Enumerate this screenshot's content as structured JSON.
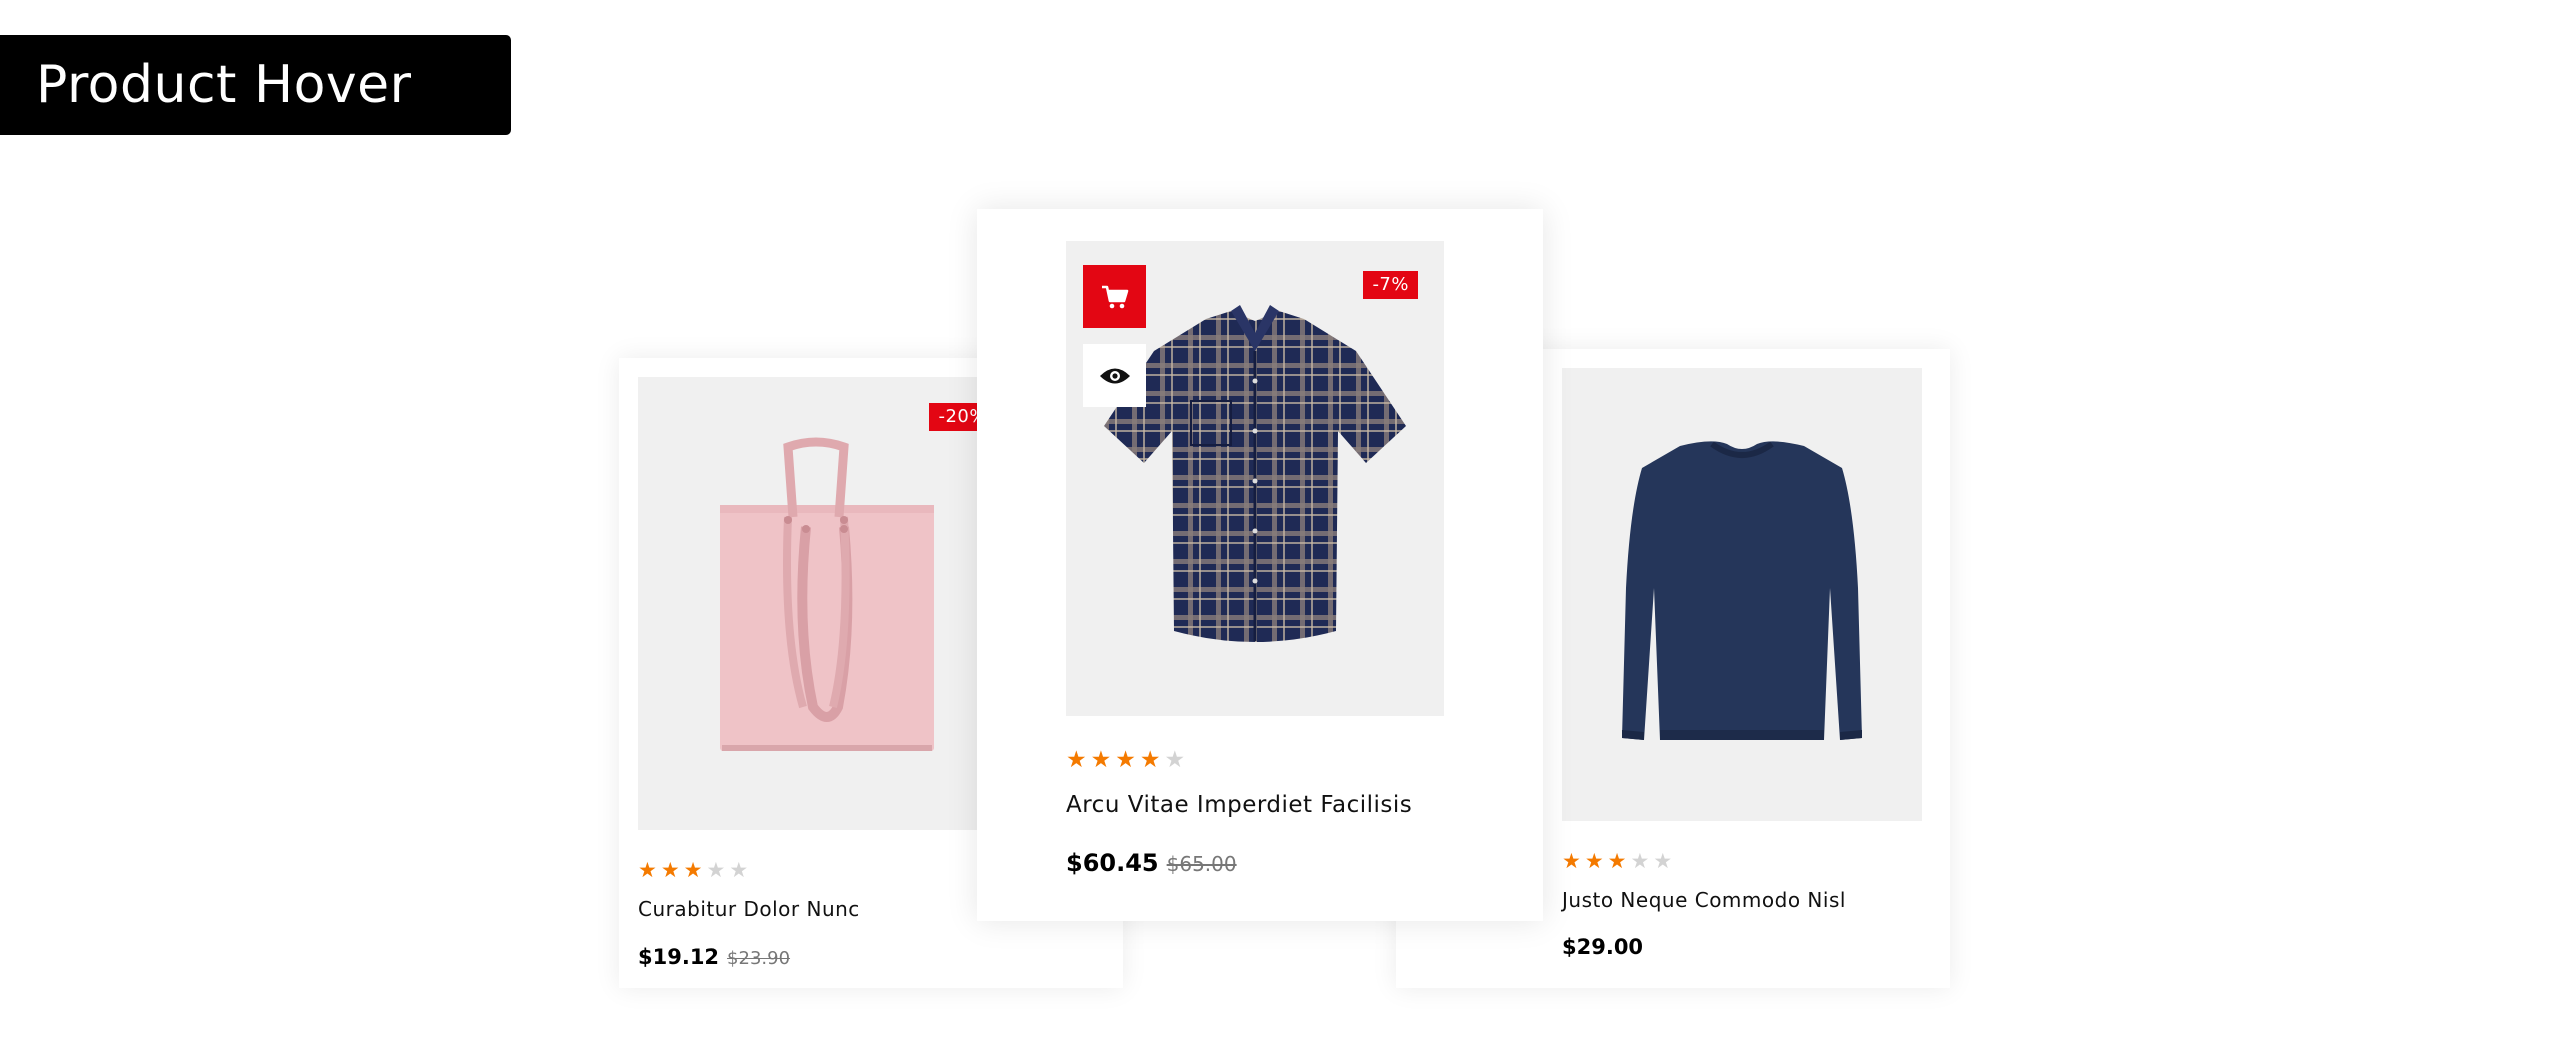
{
  "header": {
    "title": "Product Hover"
  },
  "colors": {
    "accent": "#e30613",
    "star_on": "#f47a00",
    "star_off": "#d3d3d3"
  },
  "products": [
    {
      "name": "Curabitur Dolor Nunc",
      "price": "$19.12",
      "old_price": "$23.90",
      "discount": "-20%",
      "rating": 3,
      "image": "pink-tote-bag"
    },
    {
      "name": "Arcu Vitae Imperdiet Facilisis",
      "price": "$60.45",
      "old_price": "$65.00",
      "discount": "-7%",
      "rating": 4,
      "image": "plaid-short-sleeve-shirt",
      "actions": {
        "cart_icon": "cart-icon",
        "quickview_icon": "eye-icon"
      }
    },
    {
      "name": "Justo Neque Commodo Nisl",
      "price": "$29.00",
      "rating": 3,
      "image": "navy-sweater"
    }
  ]
}
